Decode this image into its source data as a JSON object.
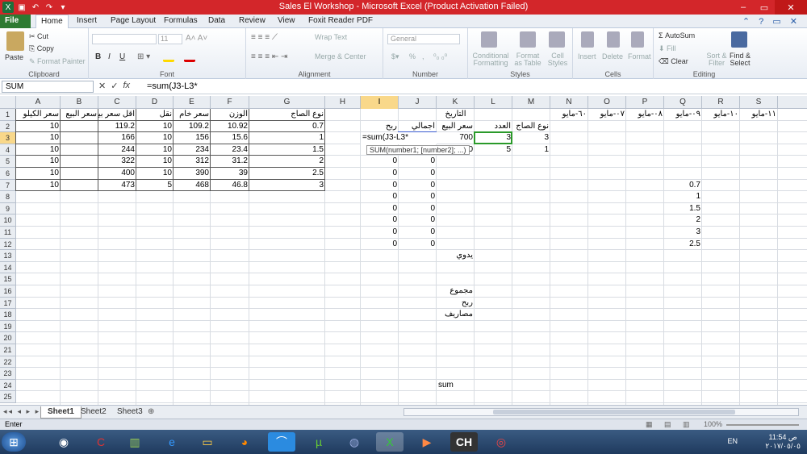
{
  "window": {
    "title": "Sales El Workshop  -  Microsoft Excel (Product Activation Failed)"
  },
  "ribbon_tabs": [
    "File",
    "Home",
    "Insert",
    "Page Layout",
    "Formulas",
    "Data",
    "Review",
    "View",
    "Foxit Reader PDF"
  ],
  "ribbon": {
    "clipboard": {
      "label": "Clipboard",
      "paste": "Paste",
      "cut": "Cut",
      "copy": "Copy",
      "format_painter": "Format Painter"
    },
    "font": {
      "label": "Font",
      "size": "11",
      "bold": "B",
      "italic": "I",
      "underline": "U"
    },
    "alignment": {
      "label": "Alignment",
      "wrap": "Wrap Text",
      "merge": "Merge & Center"
    },
    "number": {
      "label": "Number",
      "format": "General",
      "percent": "%",
      "comma": ","
    },
    "styles": {
      "label": "Styles",
      "conditional": "Conditional Formatting",
      "format_table": "Format as Table",
      "cell_styles": "Cell Styles"
    },
    "cells": {
      "label": "Cells",
      "insert": "Insert",
      "delete": "Delete",
      "format": "Format"
    },
    "editing": {
      "label": "Editing",
      "autosum": "AutoSum",
      "fill": "Fill",
      "clear": "Clear",
      "sort": "Sort & Filter",
      "find": "Find & Select"
    }
  },
  "formula_bar": {
    "name_box": "SUM",
    "fx": "fx",
    "formula": "=sum(J3-L3*"
  },
  "columns": [
    "A",
    "B",
    "C",
    "D",
    "E",
    "F",
    "G",
    "H",
    "I",
    "J",
    "K",
    "L",
    "M",
    "N",
    "O",
    "P",
    "Q",
    "R",
    "S"
  ],
  "rows": [
    "1",
    "2",
    "3",
    "4",
    "5",
    "6",
    "7",
    "8",
    "9",
    "10",
    "11",
    "12",
    "13",
    "14",
    "15",
    "16",
    "17",
    "18",
    "19",
    "20",
    "21",
    "22",
    "23",
    "24",
    "25"
  ],
  "cells": {
    "headers_left": {
      "A": "سعر الكيلو",
      "B": "سعر البيع",
      "C": "اقل سعر بيع",
      "D": "نقل",
      "E": "سعر خام",
      "F": "الوزن",
      "G": "نوع الصاج"
    },
    "left_table": [
      [
        "10",
        "",
        "119.2",
        "10",
        "109.2",
        "10.92",
        "0.7"
      ],
      [
        "10",
        "",
        "166",
        "10",
        "156",
        "15.6",
        "1"
      ],
      [
        "10",
        "",
        "244",
        "10",
        "234",
        "23.4",
        "1.5"
      ],
      [
        "10",
        "",
        "322",
        "10",
        "312",
        "31.2",
        "2"
      ],
      [
        "10",
        "",
        "400",
        "10",
        "390",
        "39",
        "2.5"
      ],
      [
        "10",
        "",
        "473",
        "5",
        "468",
        "46.8",
        "3"
      ]
    ],
    "k1": "التاريخ",
    "headers_right": {
      "I": "ربح",
      "J": "اجمالي",
      "K": "سعر البيع",
      "L": "العدد",
      "M": "نوع الصاج"
    },
    "date_headers": [
      "٦٠-مايو",
      "٠٧-مايو",
      "٠٨-مايو",
      "٠٩-مايو",
      "١٠-مايو",
      "١١-مايو"
    ],
    "row3": {
      "I": "=sum(J3-L3*",
      "K": "700",
      "L": "3",
      "M": "3"
    },
    "row4": {
      "K": "0",
      "L": "5",
      "M": "1"
    },
    "zeros": [
      "0",
      "0",
      "0",
      "0",
      "0",
      "0",
      "0",
      "0",
      "0"
    ],
    "q_col": [
      "0.7",
      "1",
      "1.5",
      "2",
      "3",
      "2.5"
    ],
    "k13": "يدوي",
    "k16": "مجموع",
    "k17": "ربح",
    "k18": "مصاريف",
    "k24": "sum",
    "tooltip": "SUM(number1; [number2]; ...)"
  },
  "sheets": [
    "Sheet1",
    "Sheet2",
    "Sheet3"
  ],
  "status": {
    "mode": "Enter",
    "zoom": "100%"
  },
  "taskbar": {
    "lang": "EN",
    "time": "11:54 ص",
    "date": "٢٠١٧/٠٥/٠٥"
  },
  "colors": {
    "titlebar": "#d3262a",
    "file_tab": "#2e7a32",
    "selection": "#2a7a2a"
  }
}
